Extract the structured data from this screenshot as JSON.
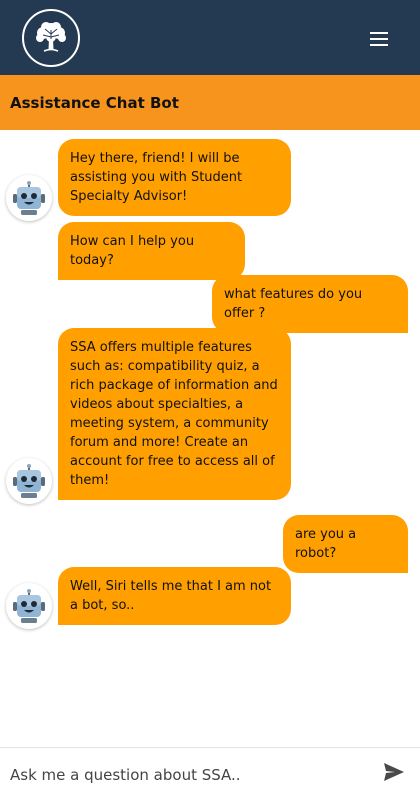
{
  "app": {
    "logo_icon": "tree-logo-icon",
    "menu_icon": "hamburger-menu-icon"
  },
  "colors": {
    "navbar": "#243a52",
    "header": "#f7941d",
    "bubble": "#ffa000",
    "send_icon": "#4a4a4a"
  },
  "chat": {
    "title": "Assistance Chat Bot",
    "messages": [
      {
        "sender": "bot",
        "text": "Hey there, friend! I will be assisting you with Student Specialty Advisor!"
      },
      {
        "sender": "bot",
        "text": "How can I help you today?"
      },
      {
        "sender": "user",
        "text": "what features do you offer ?"
      },
      {
        "sender": "bot",
        "text": "SSA offers multiple features such as: compatibility quiz, a rich package of information and videos about specialties, a meeting system, a community forum and more! Create an account for free to access all of them!"
      },
      {
        "sender": "user",
        "text": "are you a robot?"
      },
      {
        "sender": "bot",
        "text": "Well, Siri tells me that I am not a bot, so.."
      }
    ]
  },
  "input": {
    "placeholder": "Ask me a question about SSA..",
    "value": "",
    "send_icon": "send-icon"
  }
}
